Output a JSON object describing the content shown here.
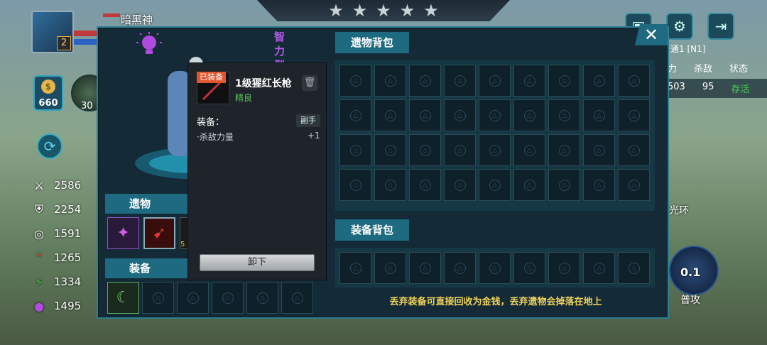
{
  "hud": {
    "stars": [
      "★",
      "★",
      "★",
      "★",
      "★"
    ],
    "player_name": "暗黑神",
    "level": "2",
    "gold": "660",
    "summon_level": "30",
    "stats": [
      {
        "icon": "sword-icon",
        "glyph": "⚔",
        "value": "2586",
        "color": "#ffffff"
      },
      {
        "icon": "shield-icon",
        "glyph": "⛨",
        "value": "2254",
        "color": "#ffffff"
      },
      {
        "icon": "target-icon",
        "glyph": "◎",
        "value": "1591",
        "color": "#ffffff"
      },
      {
        "icon": "speed-icon",
        "glyph": "⌃",
        "value": "1265",
        "color": "#e24a3a"
      },
      {
        "icon": "lightning-icon",
        "glyph": "⚡",
        "value": "1334",
        "color": "#3ac44a"
      },
      {
        "icon": "mana-icon",
        "glyph": "●",
        "value": "1495",
        "color": "#b04ae0"
      }
    ],
    "right_panel": {
      "difficulty": "通1 [N1]",
      "headers": [
        "力",
        "杀敌",
        "状态"
      ],
      "values": [
        "503",
        "95",
        "存活"
      ]
    },
    "aura_label": "光环",
    "attack_cd": "0.1",
    "attack_label": "普攻"
  },
  "panel": {
    "attribute_label": "智力型",
    "relic_section": "遗物",
    "equip_section": "装备",
    "relic_bag_title": "遗物背包",
    "equip_bag_title": "装备背包",
    "relic_bag_rows": 4,
    "relic_bag_cols": 9,
    "equip_bag_cols": 9,
    "equip_slots_count": 6,
    "relic_slot_extra": "5",
    "footer_note": "丢弃装备可直接回收为金钱，丢弃遗物会掉落在地上"
  },
  "tooltip": {
    "equipped_badge": "已装备",
    "item_name": "1级猩红长枪",
    "rarity": "精良",
    "equip_label": "装备：",
    "hand": "副手",
    "effect_name": "·杀敌力量",
    "effect_value": "+1",
    "unequip_button": "卸下"
  },
  "colors": {
    "panel_bg": "#142a36",
    "accent": "#1e6a80",
    "rarity_green": "#5bc45b",
    "note_yellow": "#f0d35a",
    "badge_orange": "#e2562f"
  }
}
